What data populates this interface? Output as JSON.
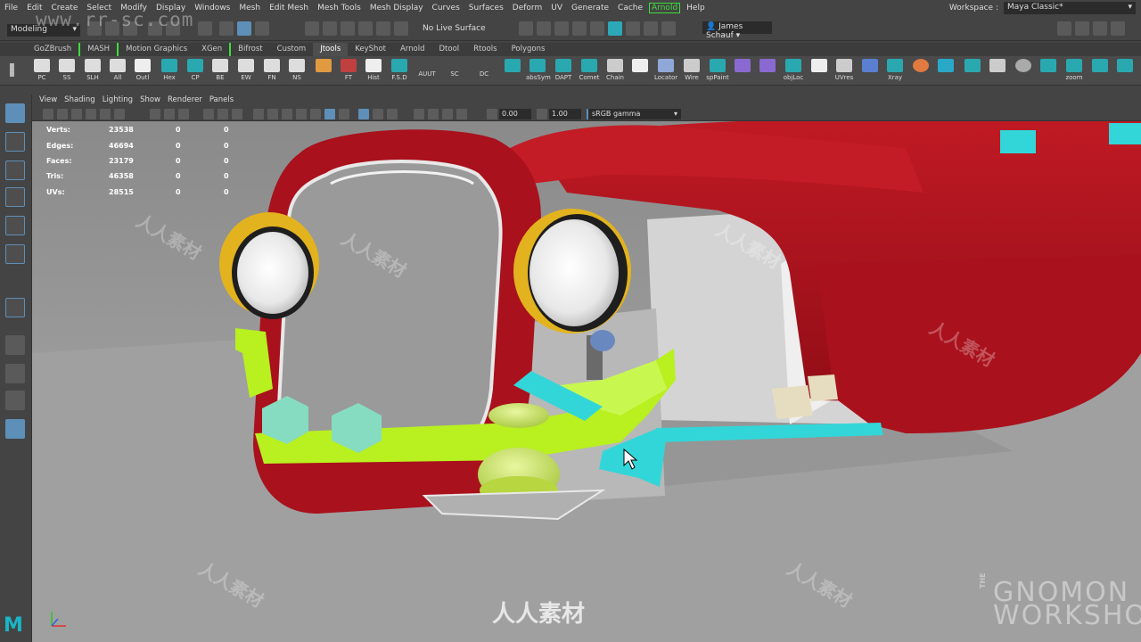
{
  "menubar": {
    "items": [
      "File",
      "Edit",
      "Create",
      "Select",
      "Modify",
      "Display",
      "Windows",
      "Mesh",
      "Edit Mesh",
      "Mesh Tools",
      "Mesh Display",
      "Curves",
      "Surfaces",
      "Deform",
      "UV",
      "Generate",
      "Cache",
      "Arnold",
      "Help"
    ],
    "workspace_label": "Workspace :",
    "workspace_value": "Maya Classic*"
  },
  "statusline": {
    "mode": "Modeling",
    "live_surface": "No Live Surface",
    "user": "James Schauf"
  },
  "shelf": {
    "tabs": [
      "GoZBrush",
      "MASH",
      "Motion Graphics",
      "XGen",
      "Bifrost",
      "Custom",
      "Jtools",
      "KeyShot",
      "Arnold",
      "Dtool",
      "Rtools",
      "Polygons"
    ],
    "active_tab": "Jtools",
    "buttons": [
      "PC",
      "SS",
      "SLH",
      "All",
      "Outl",
      "Hex",
      "CP",
      "BE",
      "EW",
      "FN",
      "NS",
      "",
      "FT",
      "Hist",
      "F.S.D",
      "AUUT",
      "SC",
      "DC",
      "",
      "absSym",
      "DAPT",
      "Comet",
      "Chain",
      "",
      "Locator",
      "Wire",
      "spPaint",
      "",
      "",
      "objLoc",
      "",
      "UVres",
      "",
      "Xray",
      "",
      "",
      "",
      "",
      "",
      "zoom",
      "",
      ""
    ]
  },
  "panel": {
    "menu": [
      "View",
      "Shading",
      "Lighting",
      "Show",
      "Renderer",
      "Panels"
    ],
    "field_a": "0.00",
    "field_b": "1.00",
    "color_space": "sRGB gamma"
  },
  "hud": {
    "rows": [
      {
        "label": "Verts:",
        "v1": "23538",
        "v2": "0",
        "v3": "0"
      },
      {
        "label": "Edges:",
        "v1": "46694",
        "v2": "0",
        "v3": "0"
      },
      {
        "label": "Faces:",
        "v1": "23179",
        "v2": "0",
        "v3": "0"
      },
      {
        "label": "Tris:",
        "v1": "46358",
        "v2": "0",
        "v3": "0"
      },
      {
        "label": "UVs:",
        "v1": "28515",
        "v2": "0",
        "v3": "0"
      }
    ]
  },
  "watermarks": {
    "url": "www.rr-sc.com",
    "cn": "人人素材",
    "gnomon_prefix": "THE",
    "gnomon_line1": "GNOMON",
    "gnomon_line2": "WORKSHOP"
  },
  "logo": "M",
  "colors": {
    "car_red": "#b4101c",
    "headlight_yellow": "#e2b31e",
    "part_lime": "#b8f020",
    "part_cyan": "#33d6d8",
    "part_mint": "#86dcc0",
    "ground": "#a2a2a2"
  }
}
